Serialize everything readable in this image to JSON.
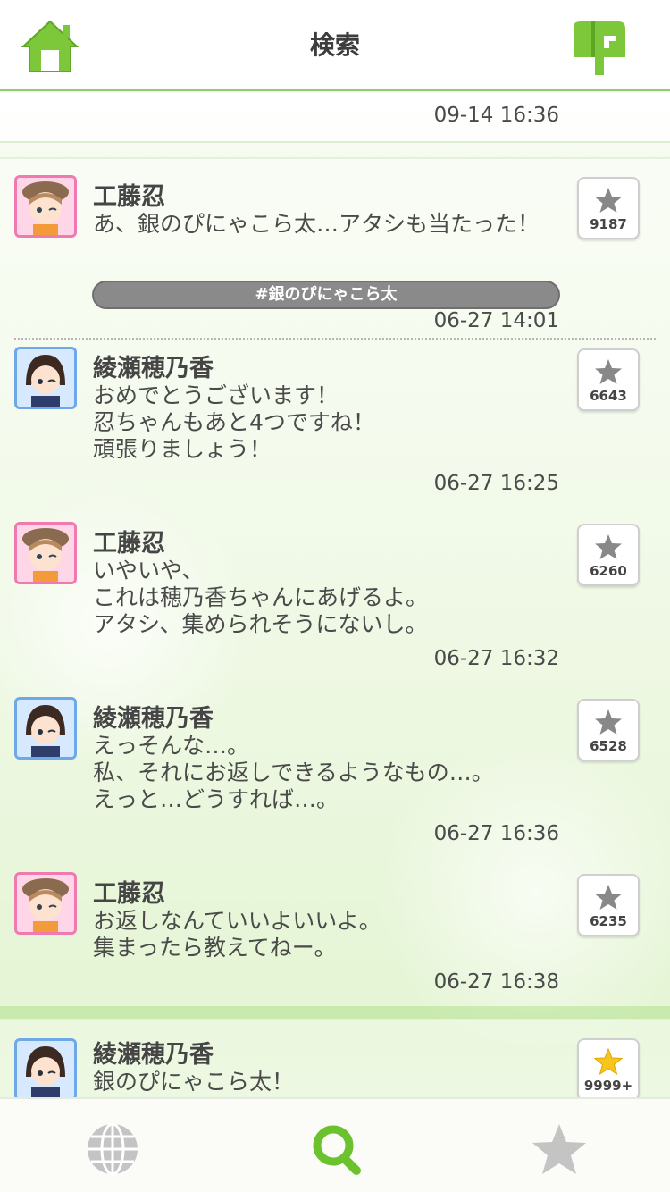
{
  "header": {
    "title": "検索",
    "home_icon": "home-icon",
    "mail_icon": "mailbox-icon",
    "accent_color": "#7cc83a"
  },
  "previous_post": {
    "timestamp": "09-14 16:36"
  },
  "thread": {
    "hashtag": "#銀のぴにゃこら太",
    "posts": [
      {
        "author": "工藤忍",
        "avatar": "avatar-kudo",
        "text": "あ、銀のぴにゃこら太…アタシも当たった！",
        "timestamp": "06-27 14:01",
        "favorites": "9187"
      },
      {
        "author": "綾瀬穂乃香",
        "avatar": "avatar-ayase",
        "text": "おめでとうございます！\n忍ちゃんもあと4つですね！\n頑張りましょう！",
        "timestamp": "06-27 16:25",
        "favorites": "6643"
      },
      {
        "author": "工藤忍",
        "avatar": "avatar-kudo",
        "text": "いやいや、\nこれは穂乃香ちゃんにあげるよ。\nアタシ、集められそうにないし。",
        "timestamp": "06-27 16:32",
        "favorites": "6260"
      },
      {
        "author": "綾瀬穂乃香",
        "avatar": "avatar-ayase",
        "text": "えっそんな…。\n私、それにお返しできるようなもの…。\nえっと…どうすれば…。",
        "timestamp": "06-27 16:36",
        "favorites": "6528"
      },
      {
        "author": "工藤忍",
        "avatar": "avatar-kudo",
        "text": "お返しなんていいよいいよ。\n集まったら教えてねー。",
        "timestamp": "06-27 16:38",
        "favorites": "6235"
      }
    ]
  },
  "next_post": {
    "author": "綾瀬穂乃香",
    "text": "銀のぴにゃこら太！",
    "favorites": "9999+"
  },
  "tabbar": {
    "items": [
      {
        "icon": "globe-icon",
        "active": false
      },
      {
        "icon": "search-icon",
        "active": true
      },
      {
        "icon": "star-icon",
        "active": false
      }
    ],
    "active_color": "#6cc12f",
    "inactive_color": "#c4c4c4"
  }
}
